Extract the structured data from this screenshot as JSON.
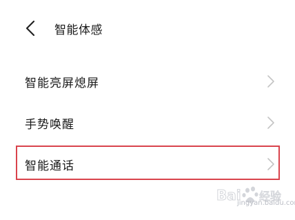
{
  "header": {
    "back_icon": "chevron-left-icon",
    "title": "智能体感"
  },
  "menu": {
    "items": [
      {
        "label": "智能亮屏熄屏",
        "icon": "chevron-right-icon",
        "highlighted": false
      },
      {
        "label": "手势唤醒",
        "icon": "chevron-right-icon",
        "highlighted": false
      },
      {
        "label": "智能通话",
        "icon": "chevron-right-icon",
        "highlighted": true
      }
    ]
  },
  "annotation": {
    "highlight_color": "#d9424b"
  },
  "watermark": {
    "logo": "Bai 经验",
    "url": "jingyan.baidu.com"
  }
}
